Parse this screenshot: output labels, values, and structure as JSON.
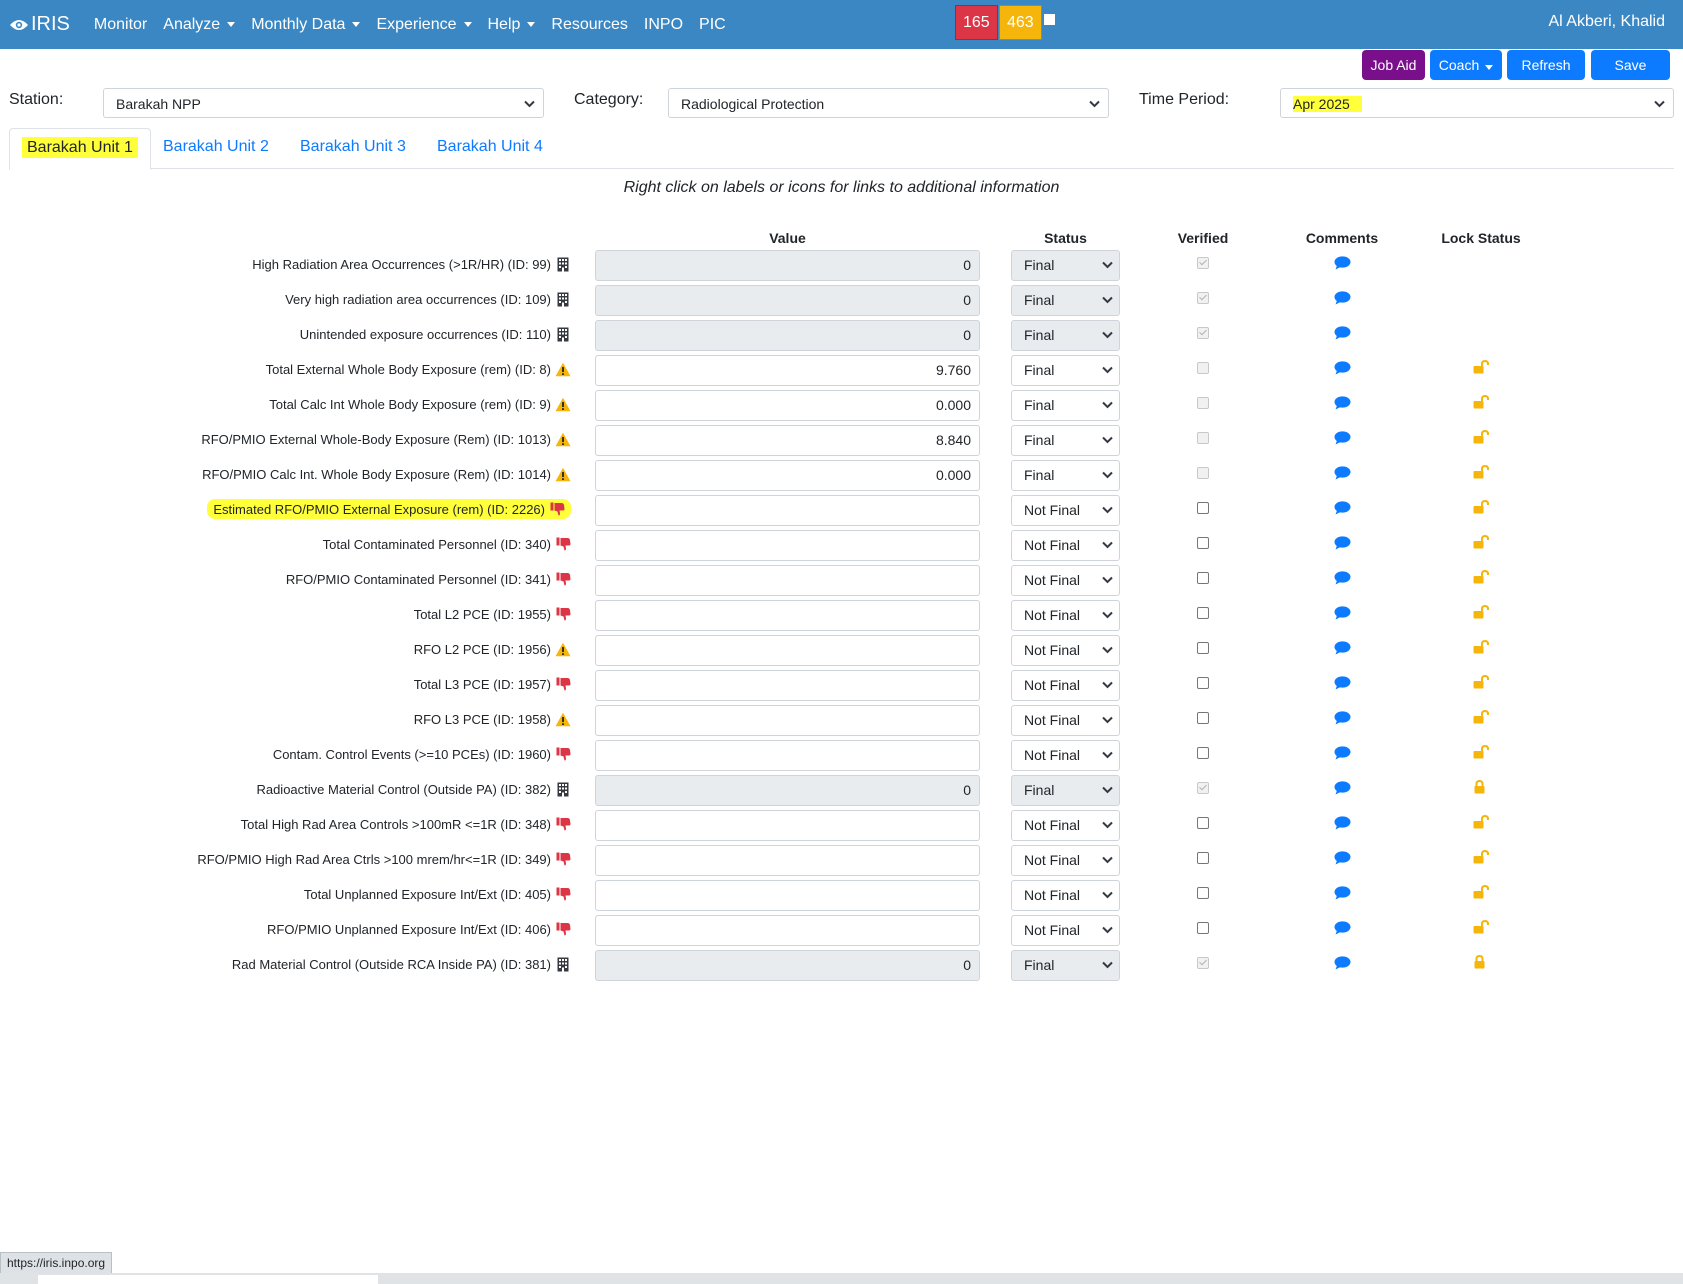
{
  "navbar": {
    "brand": "IRIS",
    "items": [
      {
        "label": "Monitor",
        "dropdown": false
      },
      {
        "label": "Analyze",
        "dropdown": true
      },
      {
        "label": "Monthly Data",
        "dropdown": true
      },
      {
        "label": "Experience",
        "dropdown": true
      },
      {
        "label": "Help",
        "dropdown": true
      },
      {
        "label": "Resources",
        "dropdown": false
      },
      {
        "label": "INPO",
        "dropdown": false
      },
      {
        "label": "PIC",
        "dropdown": false
      }
    ],
    "badge_red": "165",
    "badge_yellow": "463",
    "user": "Al Akberi, Khalid"
  },
  "actions": {
    "job_aid": "Job Aid",
    "coach": "Coach",
    "refresh": "Refresh",
    "save": "Save"
  },
  "filters": {
    "station_label": "Station:",
    "station_value": "Barakah NPP",
    "category_label": "Category:",
    "category_value": "Radiological Protection",
    "period_label": "Time Period:",
    "period_value": "Apr 2025"
  },
  "tabs": [
    "Barakah Unit 1",
    "Barakah Unit 2",
    "Barakah Unit 3",
    "Barakah Unit 4"
  ],
  "hint": "Right click on labels or icons for links to additional information",
  "columns": {
    "value": "Value",
    "status": "Status",
    "verified": "Verified",
    "comments": "Comments",
    "lock_status": "Lock Status"
  },
  "rows": [
    {
      "label": "High Radiation Area Occurrences (>1R/HR) (ID: 99)",
      "icon": "building-icon",
      "value": "0",
      "status": "Final",
      "editable": false,
      "verified": true,
      "lock": "none"
    },
    {
      "label": "Very high radiation area occurrences (ID: 109)",
      "icon": "building-icon",
      "value": "0",
      "status": "Final",
      "editable": false,
      "verified": true,
      "lock": "none"
    },
    {
      "label": "Unintended exposure occurrences (ID: 110)",
      "icon": "building-icon",
      "value": "0",
      "status": "Final",
      "editable": false,
      "verified": true,
      "lock": "none"
    },
    {
      "label": "Total External Whole Body Exposure (rem) (ID: 8)",
      "icon": "warning-icon",
      "value": "9.760",
      "status": "Final",
      "editable": true,
      "verified": false,
      "verified_disabled": true,
      "lock": "unlocked"
    },
    {
      "label": "Total Calc Int Whole Body Exposure (rem) (ID: 9)",
      "icon": "warning-icon",
      "value": "0.000",
      "status": "Final",
      "editable": true,
      "verified": false,
      "verified_disabled": true,
      "lock": "unlocked"
    },
    {
      "label": "RFO/PMIO External Whole-Body Exposure (Rem) (ID: 1013)",
      "icon": "warning-icon",
      "value": "8.840",
      "status": "Final",
      "editable": true,
      "verified": false,
      "verified_disabled": true,
      "lock": "unlocked"
    },
    {
      "label": "RFO/PMIO Calc Int. Whole Body Exposure (Rem) (ID: 1014)",
      "icon": "warning-icon",
      "value": "0.000",
      "status": "Final",
      "editable": true,
      "verified": false,
      "verified_disabled": true,
      "lock": "unlocked"
    },
    {
      "label": "Estimated RFO/PMIO External Exposure (rem) (ID: 2226)",
      "icon": "thumbs-down-icon",
      "value": "",
      "status": "Not Final",
      "editable": true,
      "verified": false,
      "lock": "unlocked",
      "highlight": true
    },
    {
      "label": "Total Contaminated Personnel (ID: 340)",
      "icon": "thumbs-down-icon",
      "value": "",
      "status": "Not Final",
      "editable": true,
      "verified": false,
      "lock": "unlocked"
    },
    {
      "label": "RFO/PMIO Contaminated Personnel (ID: 341)",
      "icon": "thumbs-down-icon",
      "value": "",
      "status": "Not Final",
      "editable": true,
      "verified": false,
      "lock": "unlocked"
    },
    {
      "label": "Total L2 PCE (ID: 1955)",
      "icon": "thumbs-down-icon",
      "value": "",
      "status": "Not Final",
      "editable": true,
      "verified": false,
      "lock": "unlocked"
    },
    {
      "label": "RFO L2 PCE (ID: 1956)",
      "icon": "warning-icon",
      "value": "",
      "status": "Not Final",
      "editable": true,
      "verified": false,
      "lock": "unlocked"
    },
    {
      "label": "Total L3 PCE (ID: 1957)",
      "icon": "thumbs-down-icon",
      "value": "",
      "status": "Not Final",
      "editable": true,
      "verified": false,
      "lock": "unlocked"
    },
    {
      "label": "RFO L3 PCE (ID: 1958)",
      "icon": "warning-icon",
      "value": "",
      "status": "Not Final",
      "editable": true,
      "verified": false,
      "lock": "unlocked"
    },
    {
      "label": "Contam. Control Events (>=10 PCEs) (ID: 1960)",
      "icon": "thumbs-down-icon",
      "value": "",
      "status": "Not Final",
      "editable": true,
      "verified": false,
      "lock": "unlocked"
    },
    {
      "label": "Radioactive Material Control (Outside PA) (ID: 382)",
      "icon": "building-icon",
      "value": "0",
      "status": "Final",
      "editable": false,
      "verified": true,
      "lock": "locked"
    },
    {
      "label": "Total High Rad Area Controls >100mR <=1R (ID: 348)",
      "icon": "thumbs-down-icon",
      "value": "",
      "status": "Not Final",
      "editable": true,
      "verified": false,
      "lock": "unlocked"
    },
    {
      "label": "RFO/PMIO High Rad Area Ctrls >100 mrem/hr<=1R (ID: 349)",
      "icon": "thumbs-down-icon",
      "value": "",
      "status": "Not Final",
      "editable": true,
      "verified": false,
      "lock": "unlocked"
    },
    {
      "label": "Total Unplanned Exposure Int/Ext (ID: 405)",
      "icon": "thumbs-down-icon",
      "value": "",
      "status": "Not Final",
      "editable": true,
      "verified": false,
      "lock": "unlocked"
    },
    {
      "label": "RFO/PMIO Unplanned Exposure Int/Ext (ID: 406)",
      "icon": "thumbs-down-icon",
      "value": "",
      "status": "Not Final",
      "editable": true,
      "verified": false,
      "lock": "unlocked"
    },
    {
      "label": "Rad Material Control (Outside RCA Inside PA) (ID: 381)",
      "icon": "building-icon",
      "value": "0",
      "status": "Final",
      "editable": false,
      "verified": true,
      "lock": "locked"
    }
  ],
  "statusbar": "https://iris.inpo.org",
  "colors": {
    "navbar": "#3a87c3",
    "primary": "#0d7bff",
    "job_aid": "#7a0f8c",
    "danger": "#dc3545",
    "warning": "#f5b50a",
    "highlight": "#ffff3a"
  }
}
